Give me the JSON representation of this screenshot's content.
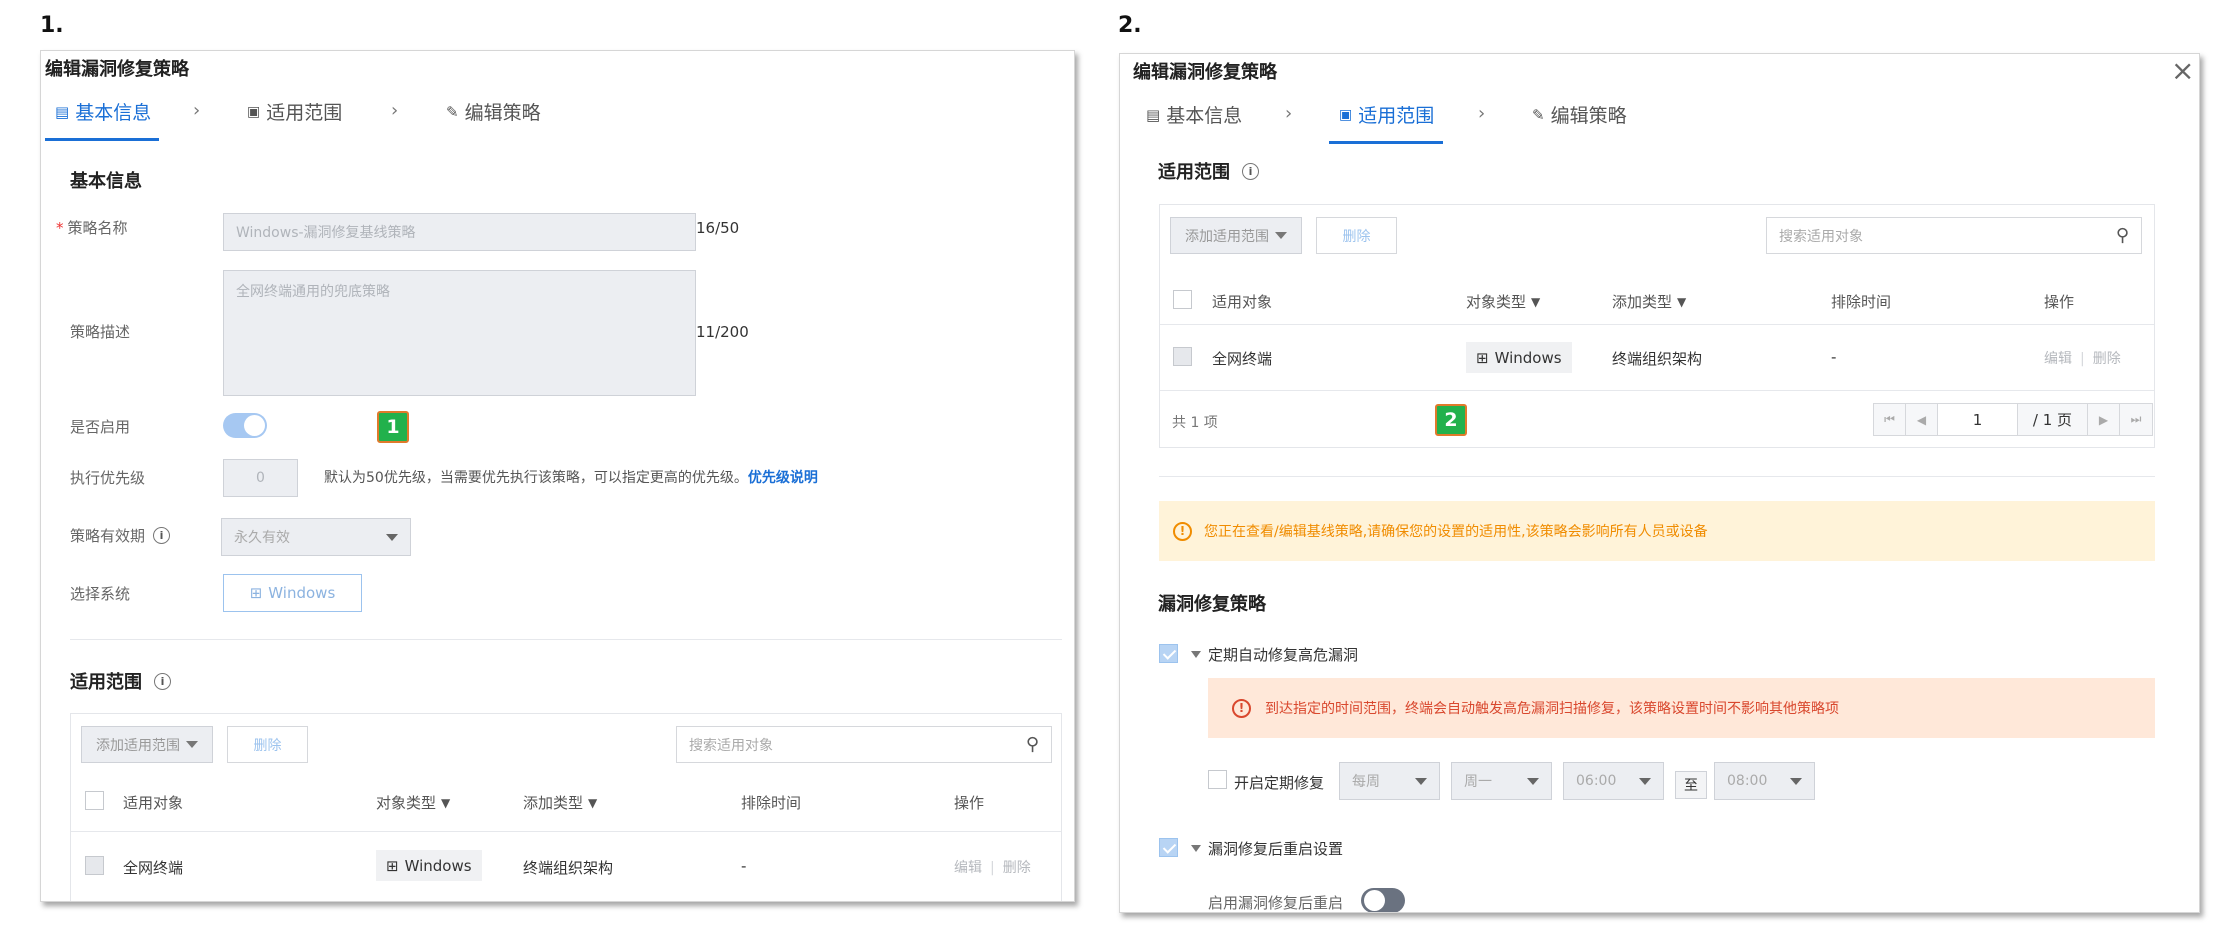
{
  "step1": "1.",
  "step2": "2.",
  "p1": {
    "title": "编辑漏洞修复策略",
    "tabs": [
      "基本信息",
      "适用范围",
      "编辑策略"
    ],
    "basic_section": "基本信息",
    "name_label": "策略名称",
    "name_value": "Windows-漏洞修复基线策略",
    "name_count": "16/50",
    "desc_label": "策略描述",
    "desc_value": "全网终端通用的兜底策略",
    "desc_count": "11/200",
    "enable_label": "是否启用",
    "priority_label": "执行优先级",
    "priority_value": "0",
    "priority_note": "默认为50优先级，当需要优先执行该策略，可以指定更高的优先级。",
    "priority_link": "优先级说明",
    "validity_label": "策略有效期",
    "validity_value": "永久有效",
    "system_label": "选择系统",
    "system_value": "Windows",
    "scope_section": "适用范围",
    "badge": "1"
  },
  "p2": {
    "title": "编辑漏洞修复策略",
    "close": "×",
    "tabs": [
      "基本信息",
      "适用范围",
      "编辑策略"
    ],
    "scope_section": "适用范围",
    "total": "共 1 项",
    "page_input": "1",
    "page_total": "/ 1 页",
    "badge": "2",
    "warning": "您正在查看/编辑基线策略,请确保您的设置的适用性,该策略会影响所有人员或设备",
    "repair_section": "漏洞修复策略",
    "auto_repair_label": "定期自动修复高危漏洞",
    "auto_repair_alert": "到达指定的时间范围，终端会自动触发高危漏洞扫描修复，该策略设置时间不影响其他策略项",
    "schedule_label": "开启定期修复",
    "schedule": {
      "freq": "每周",
      "day": "周一",
      "start": "06:00",
      "to": "至",
      "end": "08:00"
    },
    "restart_label": "漏洞修复后重启设置",
    "restart_toggle_label": "启用漏洞修复后重启"
  },
  "table": {
    "add_label": "添加适用范围",
    "delete_label": "删除",
    "search_placeholder": "搜索适用对象",
    "headers": {
      "object": "适用对象",
      "type": "对象类型",
      "add_type": "添加类型",
      "exclude": "排除时间",
      "ops": "操作"
    },
    "row": {
      "object": "全网终端",
      "type": "Windows",
      "add_type": "终端组织架构",
      "exclude": "-",
      "edit": "编辑",
      "delete": "删除"
    }
  },
  "colors": {
    "accent": "#1a6fd6",
    "badge_green": "#22b14c",
    "warning_bg": "#fff3d9",
    "alert_bg": "#ffe8d9"
  }
}
